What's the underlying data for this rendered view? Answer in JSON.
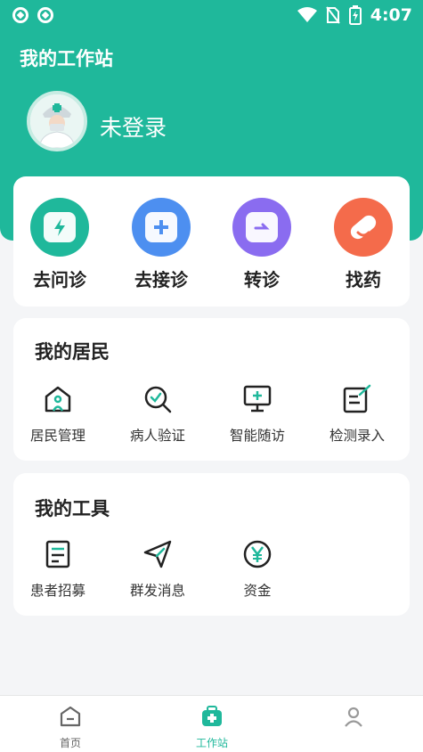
{
  "status_bar": {
    "time": "4:07"
  },
  "header": {
    "title": "我的工作站",
    "user_name": "未登录"
  },
  "quick_actions": [
    {
      "label": "去问诊",
      "icon": "lightning-chat-icon",
      "color": "#1fb89b"
    },
    {
      "label": "去接诊",
      "icon": "plus-chat-icon",
      "color": "#4d8ff0"
    },
    {
      "label": "转诊",
      "icon": "folder-arrow-icon",
      "color": "#8a6cf0"
    },
    {
      "label": "找药",
      "icon": "pill-icon",
      "color": "#f46b4b"
    }
  ],
  "residents": {
    "title": "我的居民",
    "items": [
      {
        "label": "居民管理",
        "icon": "house-person-icon"
      },
      {
        "label": "病人验证",
        "icon": "search-check-icon"
      },
      {
        "label": "智能随访",
        "icon": "monitor-plus-icon"
      },
      {
        "label": "检测录入",
        "icon": "note-edit-icon"
      }
    ]
  },
  "tools": {
    "title": "我的工具",
    "items": [
      {
        "label": "患者招募",
        "icon": "document-icon"
      },
      {
        "label": "群发消息",
        "icon": "send-icon"
      },
      {
        "label": "资金",
        "icon": "yen-coin-icon"
      }
    ]
  },
  "bottom_nav": {
    "items": [
      {
        "label": "首页",
        "active": false
      },
      {
        "label": "工作站",
        "active": true
      }
    ]
  },
  "colors": {
    "accent": "#1fb89b"
  }
}
